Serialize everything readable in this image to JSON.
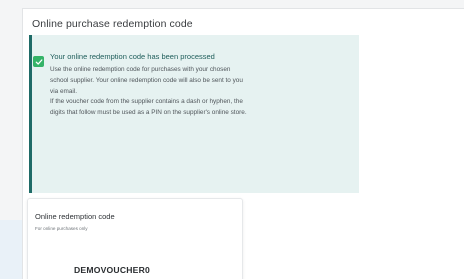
{
  "section": {
    "title": "Online purchase redemption code"
  },
  "notice": {
    "status": "success",
    "icon": "check-icon",
    "accent_color": "#1f6b67",
    "background_color": "#e6f2f1",
    "check_color": "#34b368",
    "title": "Your online redemption code has been processed",
    "lines": [
      "Use the online redemption code for purchases with your chosen",
      "school supplier. Your online redemption code will also be sent to you",
      "via email.",
      "If the voucher code from the supplier contains a dash or hyphen, the",
      "digits that follow must be used as a PIN on the supplier's online store."
    ]
  },
  "code_card": {
    "label": "Online redemption code",
    "sublabel": "For online purchases only",
    "value": "DEMOVOUCHER0"
  }
}
